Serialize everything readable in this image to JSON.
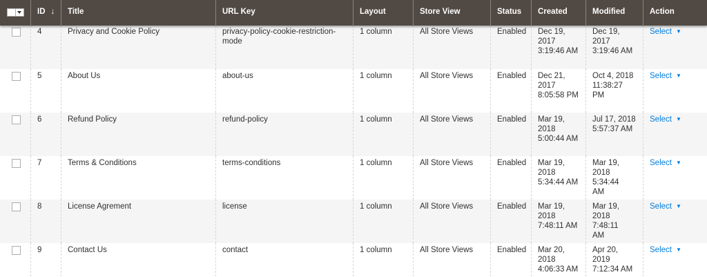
{
  "header": {
    "columns": {
      "id": "ID",
      "sort_icon": "↓",
      "title": "Title",
      "url_key": "URL Key",
      "layout": "Layout",
      "store_view": "Store View",
      "status": "Status",
      "created": "Created",
      "modified": "Modified",
      "action": "Action"
    },
    "sort_column": "ID",
    "sort_direction": "descending-arrow"
  },
  "rows": [
    {
      "id": "4",
      "title": "Privacy and Cookie Policy",
      "url_key_1": "privacy-policy-cookie-restriction-",
      "url_key_2": "mode",
      "layout": "1 column",
      "store_view": "All Store Views",
      "status": "Enabled",
      "created_1": "Dec 19,",
      "created_2": "2017",
      "created_3": "3:19:46 AM",
      "modified_1": "Dec 19, 2017",
      "modified_2": "3:19:46 AM",
      "modified_3": "",
      "action": "Select"
    },
    {
      "id": "5",
      "title": "About Us",
      "url_key_1": "about-us",
      "url_key_2": "",
      "layout": "1 column",
      "store_view": "All Store Views",
      "status": "Enabled",
      "created_1": "Dec 21,",
      "created_2": "2017",
      "created_3": "8:05:58 PM",
      "modified_1": "Oct 4, 2018",
      "modified_2": "11:38:27 PM",
      "modified_3": "",
      "action": "Select"
    },
    {
      "id": "6",
      "title": "Refund Policy",
      "url_key_1": "refund-policy",
      "url_key_2": "",
      "layout": "1 column",
      "store_view": "All Store Views",
      "status": "Enabled",
      "created_1": "Mar 19,",
      "created_2": "2018",
      "created_3": "5:00:44 AM",
      "modified_1": "Jul 17, 2018",
      "modified_2": "5:57:37 AM",
      "modified_3": "",
      "action": "Select"
    },
    {
      "id": "7",
      "title": "Terms & Conditions",
      "url_key_1": "terms-conditions",
      "url_key_2": "",
      "layout": "1 column",
      "store_view": "All Store Views",
      "status": "Enabled",
      "created_1": "Mar 19,",
      "created_2": "2018",
      "created_3": "5:34:44 AM",
      "modified_1": "Mar 19,",
      "modified_2": "2018 5:34:44",
      "modified_3": "AM",
      "action": "Select"
    },
    {
      "id": "8",
      "title": "License Agrement",
      "url_key_1": "license",
      "url_key_2": "",
      "layout": "1 column",
      "store_view": "All Store Views",
      "status": "Enabled",
      "created_1": "Mar 19,",
      "created_2": "2018",
      "created_3": "7:48:11 AM",
      "modified_1": "Mar 19,",
      "modified_2": "2018 7:48:11",
      "modified_3": "AM",
      "action": "Select"
    },
    {
      "id": "9",
      "title": "Contact Us",
      "url_key_1": "contact",
      "url_key_2": "",
      "layout": "1 column",
      "store_view": "All Store Views",
      "status": "Enabled",
      "created_1": "Mar 20,",
      "created_2": "2018",
      "created_3": "4:06:33 AM",
      "modified_1": "Apr 20, 2019",
      "modified_2": "7:12:34 AM",
      "modified_3": "",
      "action": "Select"
    }
  ],
  "colors": {
    "header_bg": "#514943",
    "row_alt_bg": "#f5f5f5",
    "link_blue": "#007bdb"
  },
  "icons": {
    "mass_select": "checkbox-dropdown-icon",
    "sort": "arrow-down-icon",
    "action_caret": "caret-down-icon"
  }
}
